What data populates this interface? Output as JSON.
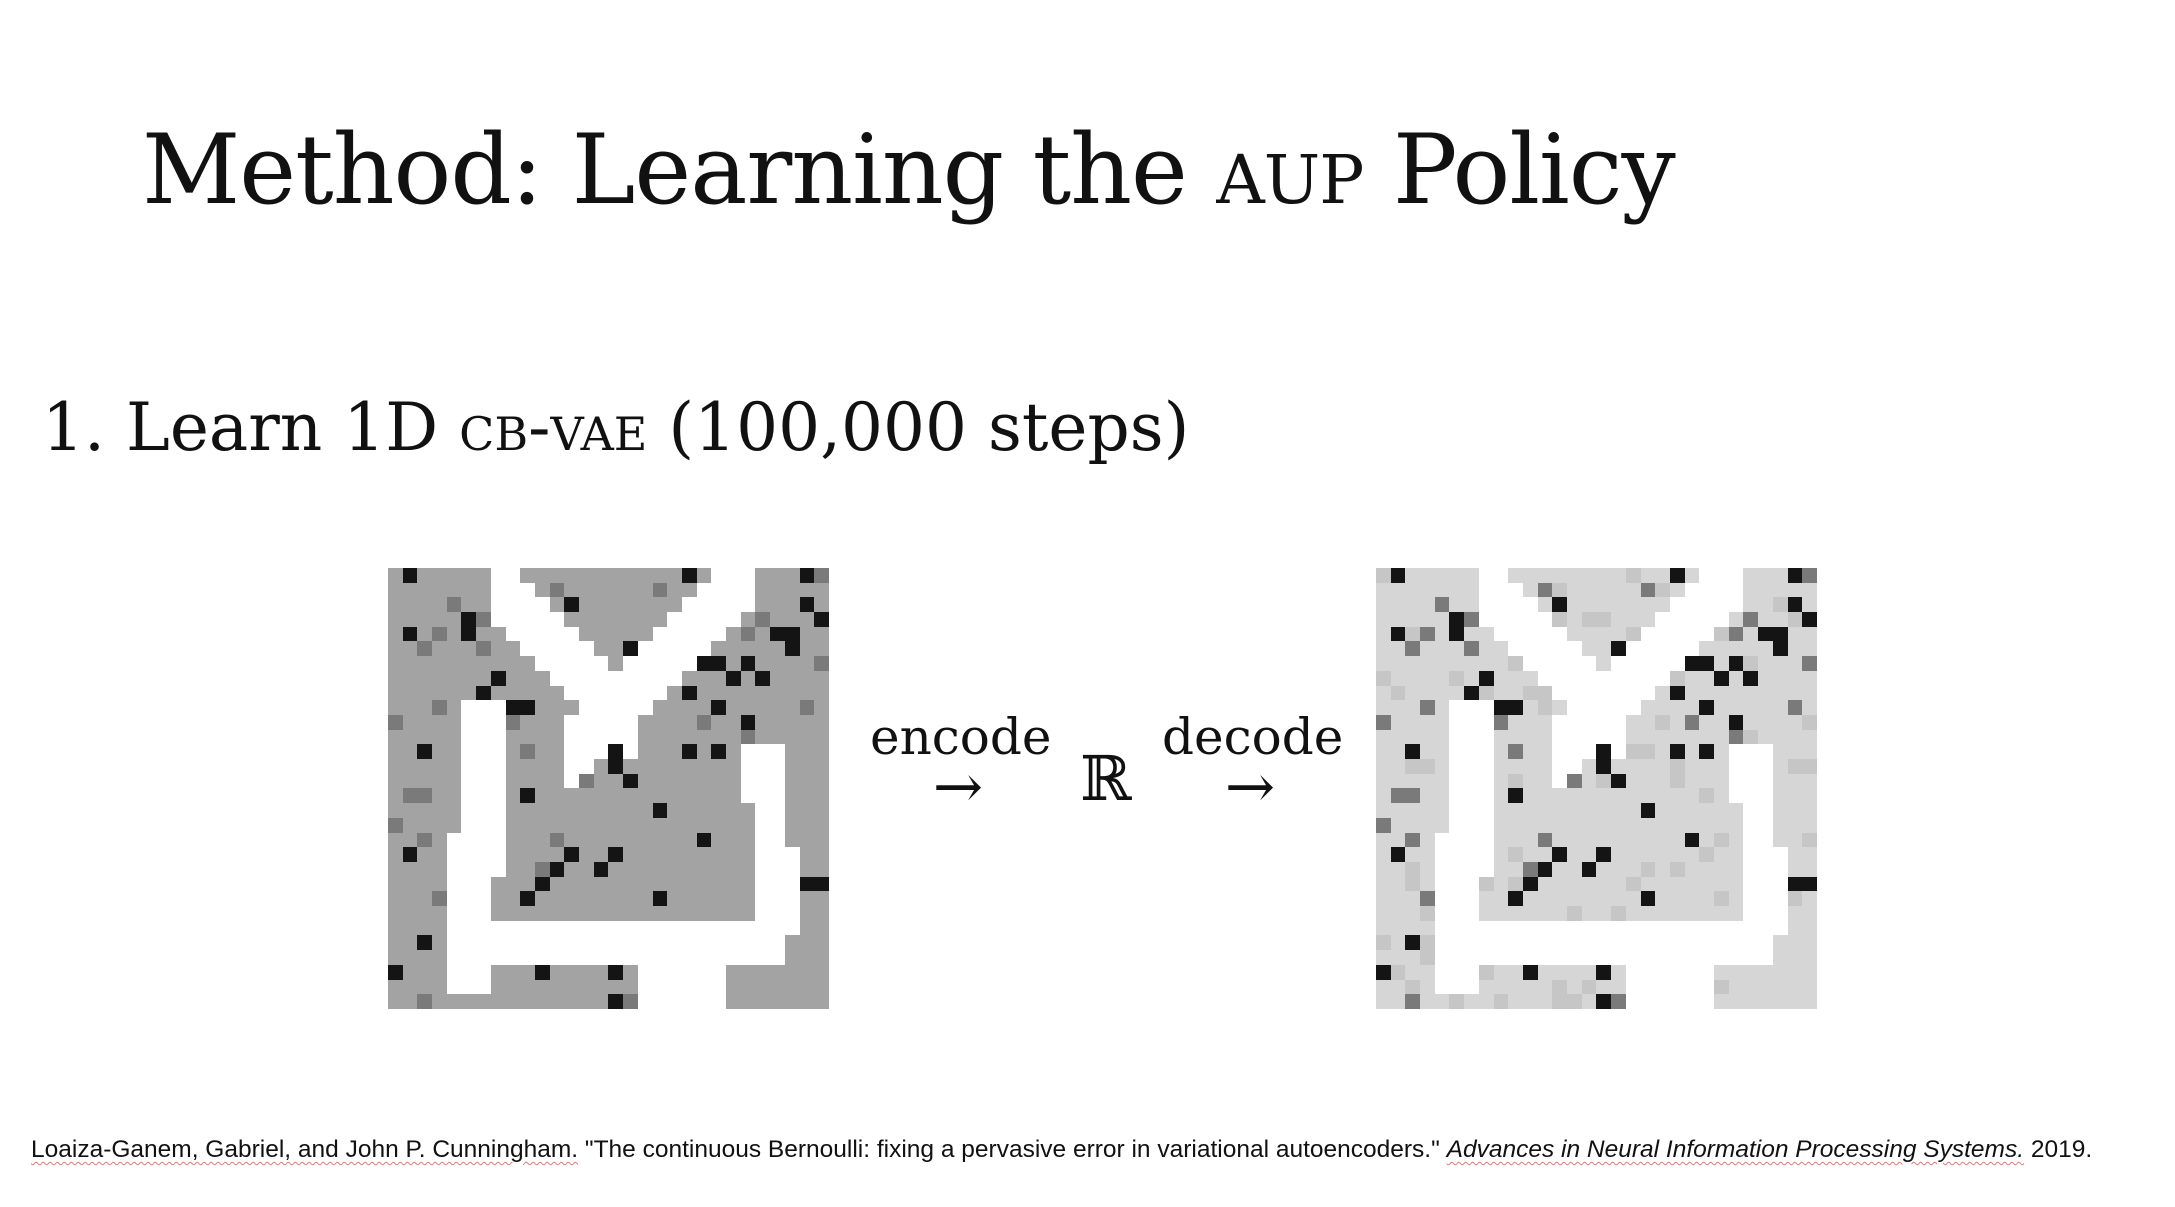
{
  "slide": {
    "title_prefix": "Method: Learning the",
    "title_sc": "AUP",
    "title_suffix": "Policy",
    "step": {
      "number": "1.",
      "text_before": "Learn 1D",
      "text_sc": "CB-VAE",
      "text_after": "(100,000 steps)"
    },
    "encode_label": "encode",
    "decode_label": "decode",
    "arrow_glyph": "→",
    "latent_symbol": "ℝ",
    "citation": {
      "authors": "Loaiza-Ganem, Gabriel, and John P. Cunningham.",
      "paper_title": "\"The continuous Bernoulli: fixing a pervasive error in variational autoencoders.\"",
      "venue": "Advances in Neural Information Processing Systems.",
      "year": "2019."
    }
  },
  "images": {
    "input_observation_icon": "pixel-grid-observation",
    "reconstruction_icon": "pixel-grid-reconstruction",
    "colors": {
      "input_floor": "#a3a3a3",
      "output_floor": "#d6d6d6",
      "path": "#ffffff",
      "object": "#141414",
      "object_faint": "#7a7a7a"
    }
  }
}
